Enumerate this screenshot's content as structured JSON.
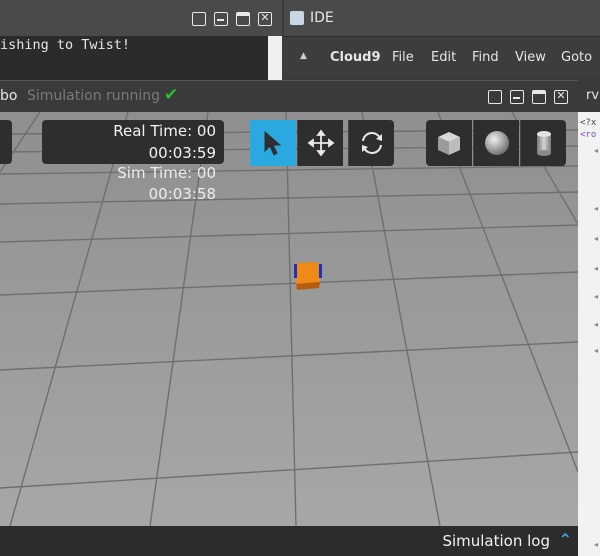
{
  "terminal": {
    "output_line": "ishing to Twist!"
  },
  "ide": {
    "title": "IDE",
    "menu": [
      "Cloud9",
      "File",
      "Edit",
      "Find",
      "View",
      "Goto"
    ]
  },
  "gazebo": {
    "title": "bo",
    "status": "Simulation running",
    "status_icon": "check-icon",
    "real_time_label": "Real Time:",
    "real_time_value_a": "00",
    "real_time_value_b": "00:03:59",
    "sim_time_label": "Sim Time:",
    "sim_time_value_a": "00",
    "sim_time_value_b": "00:03:58",
    "tools": [
      "select-arrow-icon",
      "translate-icon",
      "rotate-icon"
    ],
    "shapes": [
      "box-icon",
      "sphere-icon",
      "cylinder-icon"
    ],
    "sim_log_label": "Simulation log"
  },
  "rviz": {
    "tab_label": "rvi",
    "code_lines": [
      "<?x",
      "<ro"
    ]
  },
  "colors": {
    "accent_blue": "#2aa9e0",
    "robot_orange": "#f08a16",
    "floor": "#a6a6a6",
    "status_green": "#2bbf2b"
  }
}
